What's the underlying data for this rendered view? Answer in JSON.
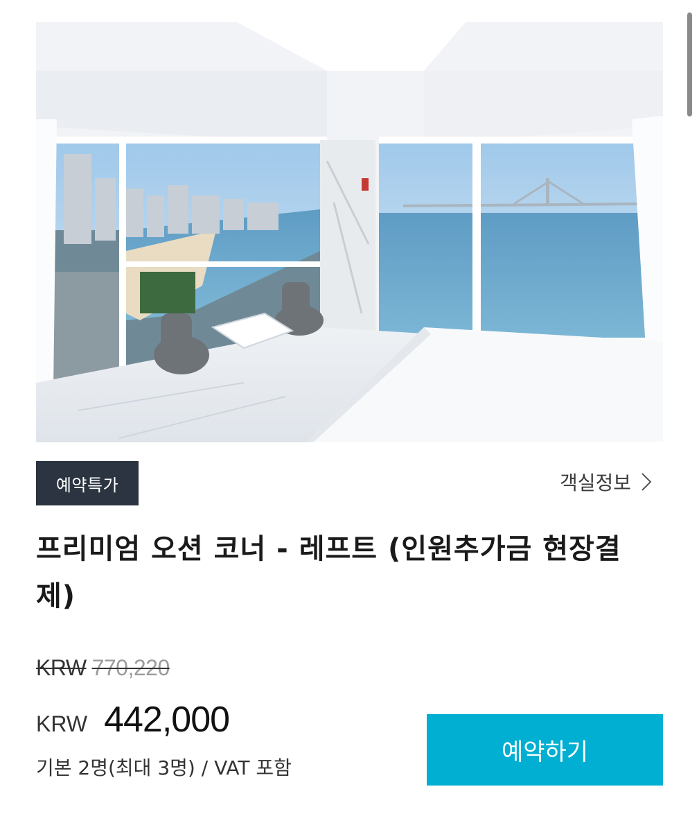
{
  "room_photo": {
    "alt": "room photo"
  },
  "badge": {
    "label": "예약특가"
  },
  "room_info_link": {
    "label": "객실정보",
    "icon": "chevron-right-icon"
  },
  "room": {
    "title": "프리미엄 오션 코너 - 레프트 (인원추가금 현장결제)"
  },
  "price": {
    "original_currency": "KRW",
    "original_amount": "770,220",
    "sale_currency": "KRW",
    "sale_amount": "442,000"
  },
  "occupancy": {
    "text": "기본 2명(최대 3명) / VAT 포함"
  },
  "book_button": {
    "label": "예약하기"
  },
  "colors": {
    "badge_bg": "#2b3440",
    "button_bg": "#00afd1"
  }
}
